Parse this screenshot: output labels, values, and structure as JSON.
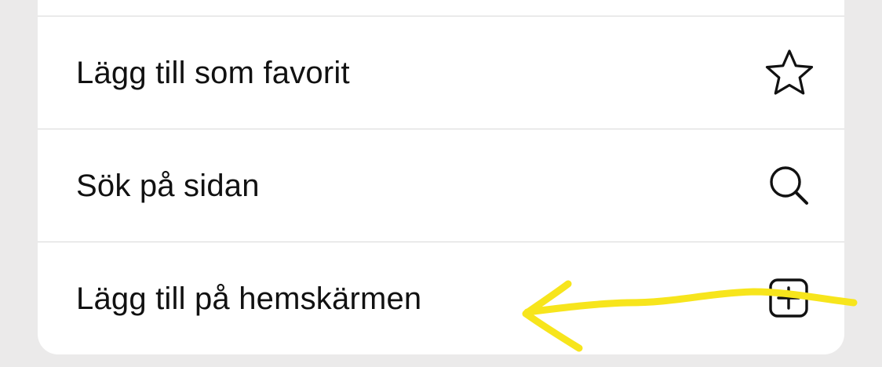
{
  "menu": {
    "items": [
      {
        "label": "Lägg till som favorit",
        "icon": "star-icon"
      },
      {
        "label": "Sök på sidan",
        "icon": "magnifier-icon"
      },
      {
        "label": "Lägg till på hemskärmen",
        "icon": "add-square-icon"
      }
    ]
  },
  "annotation": {
    "type": "hand-drawn arrow",
    "color": "#f7e51c"
  },
  "colors": {
    "background": "#ebeaea",
    "sheet": "#ffffff",
    "divider": "#d9d9d9",
    "text": "#111111"
  }
}
